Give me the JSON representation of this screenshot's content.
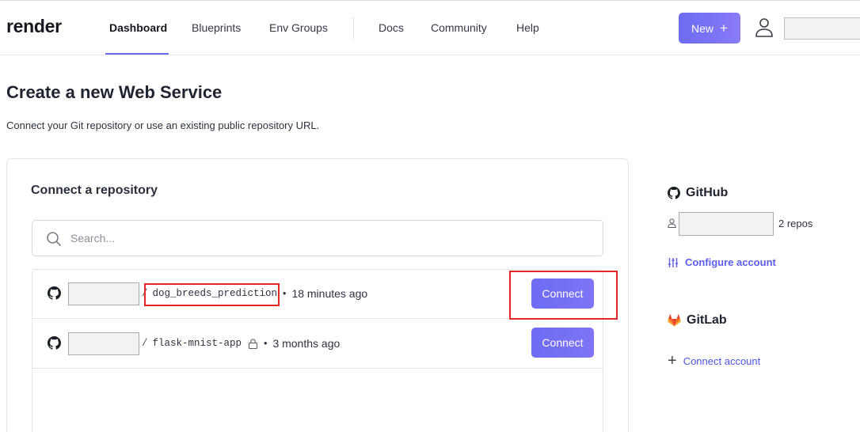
{
  "nav": {
    "logo": "render",
    "links": [
      "Dashboard",
      "Blueprints",
      "Env Groups",
      "Docs",
      "Community",
      "Help"
    ],
    "active": "Dashboard",
    "new_button": "New",
    "new_button_plus": "+"
  },
  "header": {
    "title_prefix": "Create a new ",
    "title_bold": "Web Service",
    "subtitle": "Connect your Git repository or use an existing public repository URL."
  },
  "repo_card": {
    "title": "Connect a repository",
    "search_placeholder": "Search...",
    "repos": [
      {
        "name": "dog_breeds_prediction",
        "separator": "/",
        "updated": "18 minutes ago",
        "private": false,
        "button": "Connect"
      },
      {
        "name": "flask-mnist-app",
        "separator": "/",
        "updated": "3 months ago",
        "private": true,
        "button": "Connect"
      }
    ]
  },
  "sidebar": {
    "github": {
      "title": "GitHub",
      "repo_count": "2 repos",
      "configure": "Configure account"
    },
    "gitlab": {
      "title": "GitLab",
      "connect": "Connect account",
      "connect_plus": "+"
    }
  },
  "colors": {
    "accent": "#6c6cf4",
    "highlight": "#e32626",
    "link": "#5a5df0",
    "gitlab": "#e2432a"
  }
}
